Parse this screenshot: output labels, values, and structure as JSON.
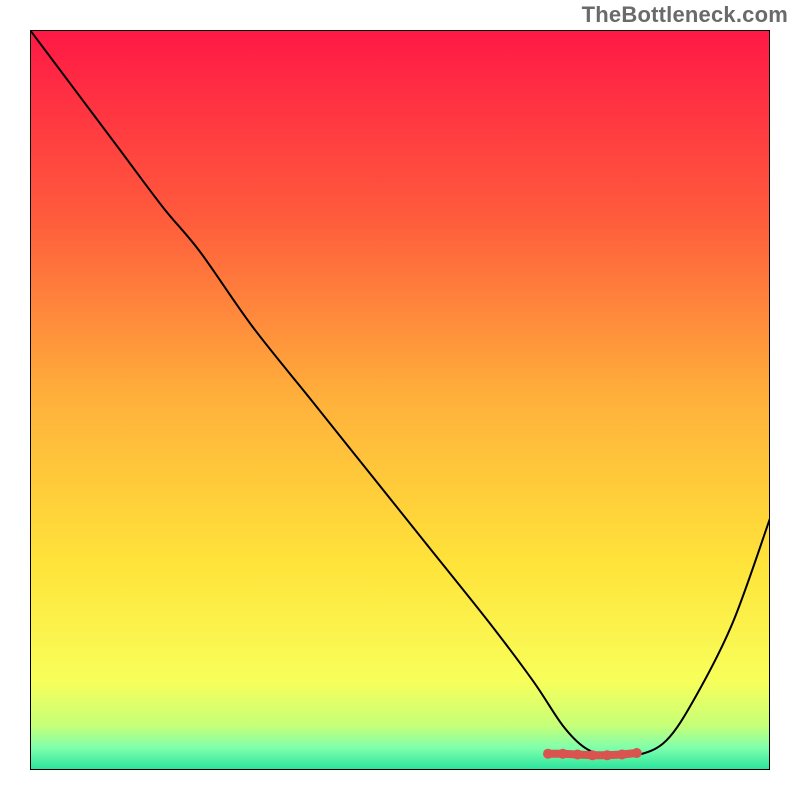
{
  "attribution": "TheBottleneck.com",
  "chart_data": {
    "type": "line",
    "title": "",
    "xlabel": "",
    "ylabel": "",
    "xlim": [
      0,
      100
    ],
    "ylim": [
      0,
      100
    ],
    "grid": false,
    "legend": false,
    "series": [
      {
        "name": "bottleneck-curve",
        "color": "#000000",
        "x": [
          0,
          6,
          12,
          18,
          23,
          30,
          38,
          46,
          54,
          62,
          68,
          72,
          75,
          78,
          82,
          86,
          90,
          95,
          100
        ],
        "y": [
          100,
          92,
          84,
          76,
          70,
          60,
          50,
          40,
          30,
          20,
          12,
          6,
          3,
          2,
          2,
          4,
          10,
          20,
          34
        ]
      }
    ],
    "annotations": [
      {
        "name": "optimal-marker",
        "color": "#d9534f",
        "x": [
          70,
          72,
          74,
          76,
          78,
          80,
          82
        ],
        "y": [
          2.2,
          2.2,
          2.1,
          2.0,
          2.0,
          2.1,
          2.3
        ]
      }
    ],
    "background_gradient": {
      "stops": [
        {
          "offset": 0,
          "color": "#ff1846"
        },
        {
          "offset": 0.25,
          "color": "#ff5a3c"
        },
        {
          "offset": 0.5,
          "color": "#ffb13b"
        },
        {
          "offset": 0.72,
          "color": "#ffe33a"
        },
        {
          "offset": 0.88,
          "color": "#f8ff5a"
        },
        {
          "offset": 0.94,
          "color": "#c6ff78"
        },
        {
          "offset": 0.97,
          "color": "#7fffac"
        },
        {
          "offset": 1.0,
          "color": "#28e39c"
        }
      ]
    }
  }
}
